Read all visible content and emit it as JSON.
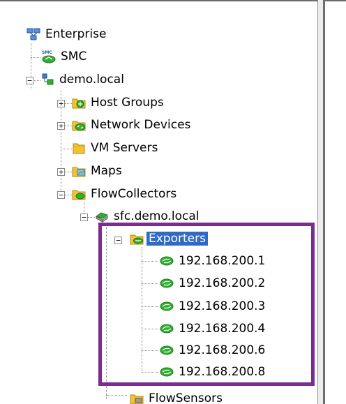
{
  "tree": {
    "root": "Enterprise",
    "smc": "SMC",
    "domain": "demo.local",
    "host_groups": "Host Groups",
    "network_devices": "Network Devices",
    "vm_servers": "VM Servers",
    "maps": "Maps",
    "flow_collectors": "FlowCollectors",
    "collector": "sfc.demo.local",
    "exporters": "Exporters",
    "exporter_ips": [
      "192.168.200.1",
      "192.168.200.2",
      "192.168.200.3",
      "192.168.200.4",
      "192.168.200.6",
      "192.168.200.8"
    ],
    "flow_sensors": "FlowSensors",
    "smc_badge": "SMC"
  },
  "colors": {
    "selection": "#316ac5",
    "highlight_border": "#7b2c8f",
    "icon_green": "#2fae2f",
    "folder_yellow": "#f2c230"
  }
}
